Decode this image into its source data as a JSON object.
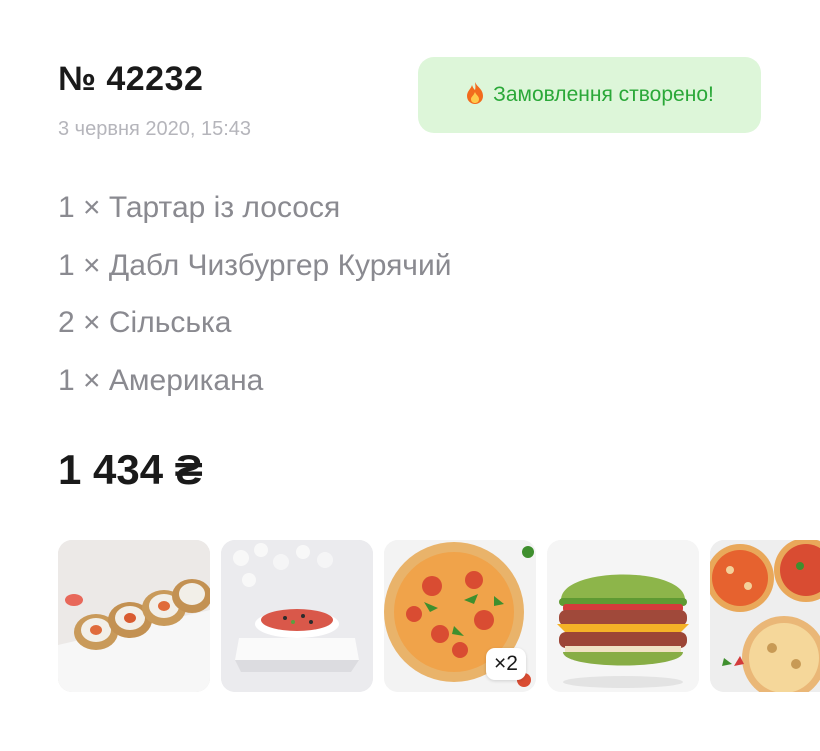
{
  "order": {
    "number": "№ 42232",
    "date": "3 червня 2020, 15:43",
    "status_icon": "fire-icon",
    "status_text": "Замовлення створено!",
    "status_color": "#2aa838",
    "status_bg": "#ddf6d9"
  },
  "items": [
    "1 × Тартар із лосося",
    "1 × Дабл Чизбургер Курячий",
    "2 × Сільська",
    "1 × Американа"
  ],
  "total": "1 434 ₴",
  "thumbnails": [
    {
      "name": "sushi-rolls-image",
      "qty": null
    },
    {
      "name": "salmon-tartare-image",
      "qty": null
    },
    {
      "name": "pizza-silska-image",
      "qty": "×2"
    },
    {
      "name": "chicken-double-cheeseburger-image",
      "qty": null
    },
    {
      "name": "pizza-americana-image",
      "qty": null
    }
  ]
}
